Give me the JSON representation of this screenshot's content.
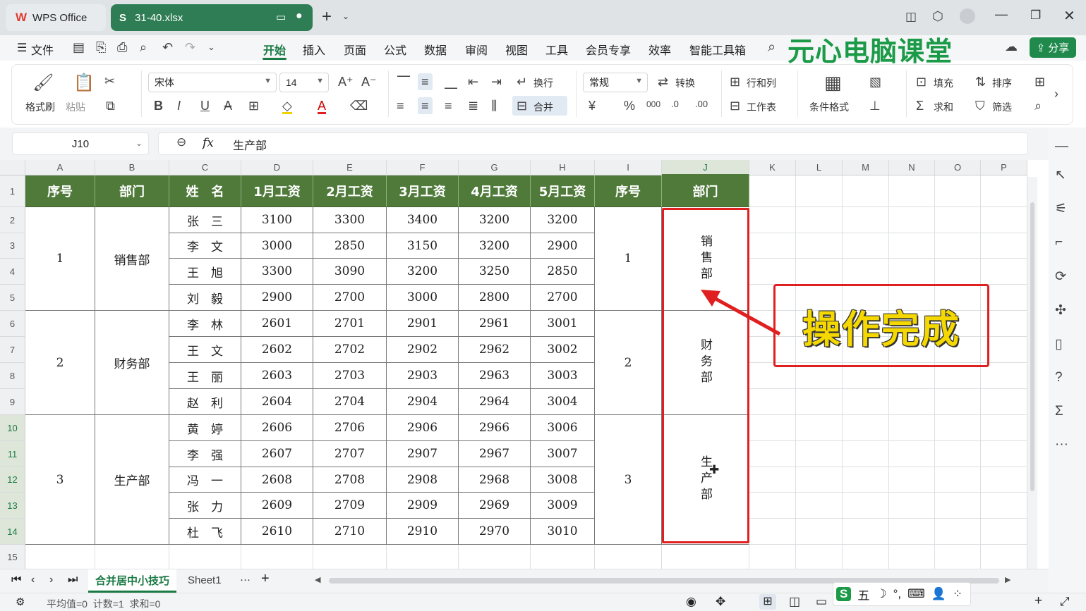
{
  "titlebar": {
    "app_tab": "WPS Office",
    "file_tab": "31-40.xlsx"
  },
  "menu": {
    "file": "文件",
    "items": [
      "开始",
      "插入",
      "页面",
      "公式",
      "数据",
      "审阅",
      "视图",
      "工具",
      "会员专享",
      "效率",
      "智能工具箱"
    ],
    "brand": "元心电脑课堂",
    "share": "分享"
  },
  "ribbon": {
    "format_painter": "格式刷",
    "paste": "粘贴",
    "font_name": "宋体",
    "font_size": "14",
    "wrap": "换行",
    "merge": "合并",
    "number_format": "常规",
    "convert": "转换",
    "row_col": "行和列",
    "worksheet": "工作表",
    "cond_format": "条件格式",
    "fill": "填充",
    "sort": "排序",
    "sum": "求和",
    "filter": "筛选",
    "currency": "¥",
    "percent": "%",
    "thousands": "000"
  },
  "formula_bar": {
    "cell_ref": "J10",
    "fx": "fx",
    "content": "生产部"
  },
  "columns": [
    "A",
    "B",
    "C",
    "D",
    "E",
    "F",
    "G",
    "H",
    "I",
    "J",
    "K",
    "L",
    "M",
    "N",
    "O",
    "P"
  ],
  "rows": [
    "1",
    "2",
    "3",
    "4",
    "5",
    "6",
    "7",
    "8",
    "9",
    "10",
    "11",
    "12",
    "13",
    "14",
    "15"
  ],
  "table": {
    "headers": [
      "序号",
      "部门",
      "姓　名",
      "1月工资",
      "2月工资",
      "3月工资",
      "4月工资",
      "5月工资",
      "序号",
      "部门"
    ],
    "groups": [
      {
        "seq": "1",
        "dept": "销售部",
        "rows": [
          [
            "张　三",
            "3100",
            "3300",
            "3400",
            "3200",
            "3200"
          ],
          [
            "李　文",
            "3000",
            "2850",
            "3150",
            "3200",
            "2900"
          ],
          [
            "王　旭",
            "3300",
            "3090",
            "3200",
            "3250",
            "2850"
          ],
          [
            "刘　毅",
            "2900",
            "2700",
            "3000",
            "2800",
            "2700"
          ]
        ]
      },
      {
        "seq": "2",
        "dept": "财务部",
        "rows": [
          [
            "李　林",
            "2601",
            "2701",
            "2901",
            "2961",
            "3001"
          ],
          [
            "王　文",
            "2602",
            "2702",
            "2902",
            "2962",
            "3002"
          ],
          [
            "王　丽",
            "2603",
            "2703",
            "2903",
            "2963",
            "3003"
          ],
          [
            "赵　利",
            "2604",
            "2704",
            "2904",
            "2964",
            "3004"
          ]
        ]
      },
      {
        "seq": "3",
        "dept": "生产部",
        "rows": [
          [
            "黄　婷",
            "2606",
            "2706",
            "2906",
            "2966",
            "3006"
          ],
          [
            "李　强",
            "2607",
            "2707",
            "2907",
            "2967",
            "3007"
          ],
          [
            "冯　一",
            "2608",
            "2708",
            "2908",
            "2968",
            "3008"
          ],
          [
            "张　力",
            "2609",
            "2709",
            "2909",
            "2969",
            "3009"
          ],
          [
            "杜　飞",
            "2610",
            "2710",
            "2910",
            "2970",
            "3010"
          ]
        ]
      }
    ]
  },
  "callout": "操作完成",
  "sheet_tabs": {
    "active": "合并居中小技巧",
    "other": "Sheet1",
    "more": "···"
  },
  "status": {
    "text": "平均值=0  计数=1  求和=0"
  },
  "colors": {
    "header_green": "#4f7a3a",
    "accent_green": "#1a7a44",
    "tab_green": "#2e7d55",
    "highlight_red": "#e02020",
    "callout_yellow": "#f5d800"
  }
}
